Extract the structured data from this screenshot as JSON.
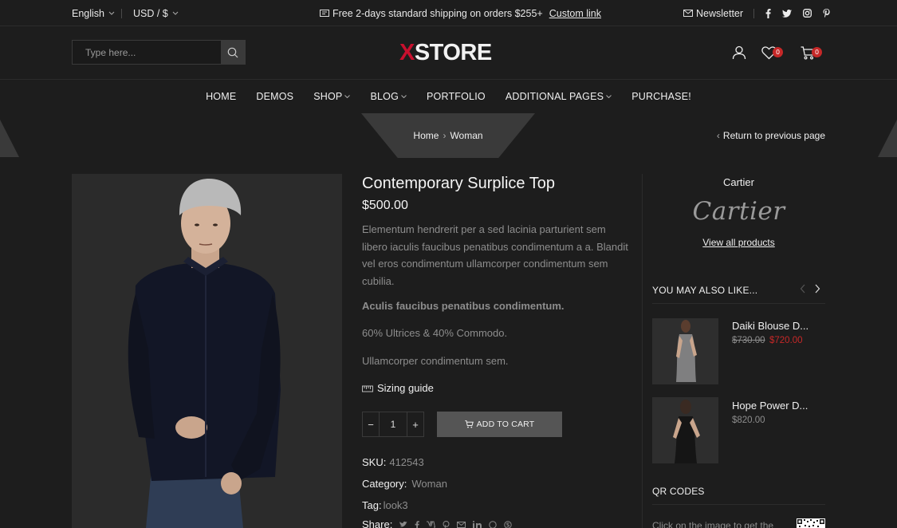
{
  "topbar": {
    "language": "English",
    "currency": "USD / $",
    "shipping_text": "Free 2-days standard shipping on orders $255+",
    "custom_link": "Custom link",
    "newsletter": "Newsletter"
  },
  "search": {
    "placeholder": "Type here..."
  },
  "logo": {
    "x": "X",
    "rest": "STORE"
  },
  "header_icons": {
    "wishlist_count": "0",
    "cart_count": "0"
  },
  "nav": [
    {
      "label": "HOME",
      "dropdown": false
    },
    {
      "label": "DEMOS",
      "dropdown": false
    },
    {
      "label": "SHOP",
      "dropdown": true
    },
    {
      "label": "BLOG",
      "dropdown": true
    },
    {
      "label": "PORTFOLIO",
      "dropdown": false
    },
    {
      "label": "ADDITIONAL PAGES",
      "dropdown": true
    },
    {
      "label": "PURCHASE!",
      "dropdown": false
    }
  ],
  "breadcrumb": {
    "home": "Home",
    "current": "Woman",
    "return": "Return to previous page"
  },
  "product": {
    "title": "Contemporary Surplice Top",
    "price": "$500.00",
    "description": "Elementum hendrerit per a sed lacinia parturient sem libero iaculis faucibus penatibus condimentum a a. Blandit vel eros condimentum ullamcorper condimentum sem cubilia.",
    "strong_line": "Aculis faucibus penatibus condimentum.",
    "line2": "60% Ultrices & 40% Commodo.",
    "line3": "Ullamcorper condimentum sem.",
    "sizing_guide": "Sizing guide",
    "quantity": "1",
    "add_to_cart": "ADD TO CART",
    "sku_label": "SKU:",
    "sku": "412543",
    "category_label": "Category:",
    "category": "Woman",
    "tag_label": "Tag:",
    "tag": "look3",
    "share_label": "Share:"
  },
  "sidebar": {
    "brand_name": "Cartier",
    "brand_logo": "Cartier",
    "view_all": "View all products",
    "you_may_also_like": "YOU MAY ALSO LIKE...",
    "items": [
      {
        "name": "Daiki Blouse D...",
        "old_price": "$730.00",
        "price": "$720.00"
      },
      {
        "name": "Hope Power D...",
        "price": "$820.00"
      }
    ],
    "qr_title": "QR CODES",
    "qr_text": "Click on the image to get the"
  },
  "colors": {
    "background": "#1d1d1d",
    "accent": "#c8102e",
    "badge": "#c62828",
    "muted_text": "#8d8d8d"
  }
}
